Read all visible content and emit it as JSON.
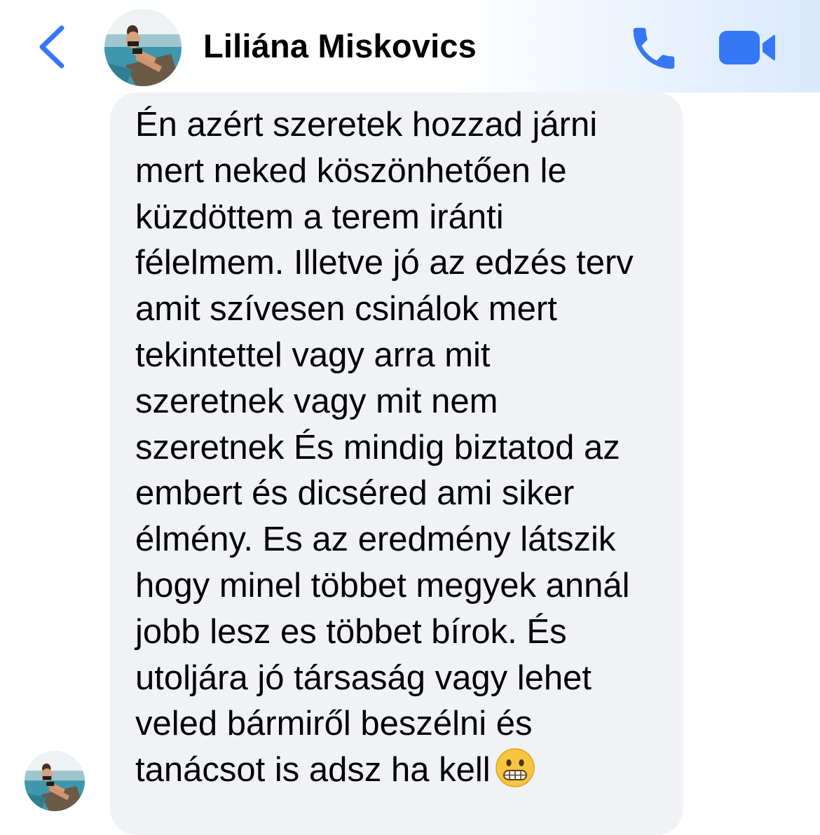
{
  "header": {
    "back_icon": "chevron-left-icon",
    "contact_name": "Liliána Miskovics",
    "call_icon": "phone-icon",
    "video_icon": "video-camera-icon",
    "accent_color": "#3478f6"
  },
  "conversation": {
    "message": {
      "bubble_color": "#f0f2f6",
      "lines": [
        "Én azért szeretek hozzad járni",
        "mert neked köszönhetően le",
        "küzdöttem a terem iránti",
        "félelmem. Illetve jó az edzés terv",
        "amit szívesen csinálok mert",
        "tekintettel vagy arra mit",
        "szeretnek vagy mit nem",
        "szeretnek És mindig biztatod az",
        "embert és dicséred ami siker",
        "élmény. Es az eredmény látszik",
        "hogy minel többet megyek annál",
        "jobb lesz es többet bírok. És",
        "utoljára jó társaság vagy lehet",
        "veled bármiről beszélni és",
        "tanácsot is adsz ha kell"
      ],
      "trailing_emoji": "grimacing-face-emoji"
    }
  }
}
